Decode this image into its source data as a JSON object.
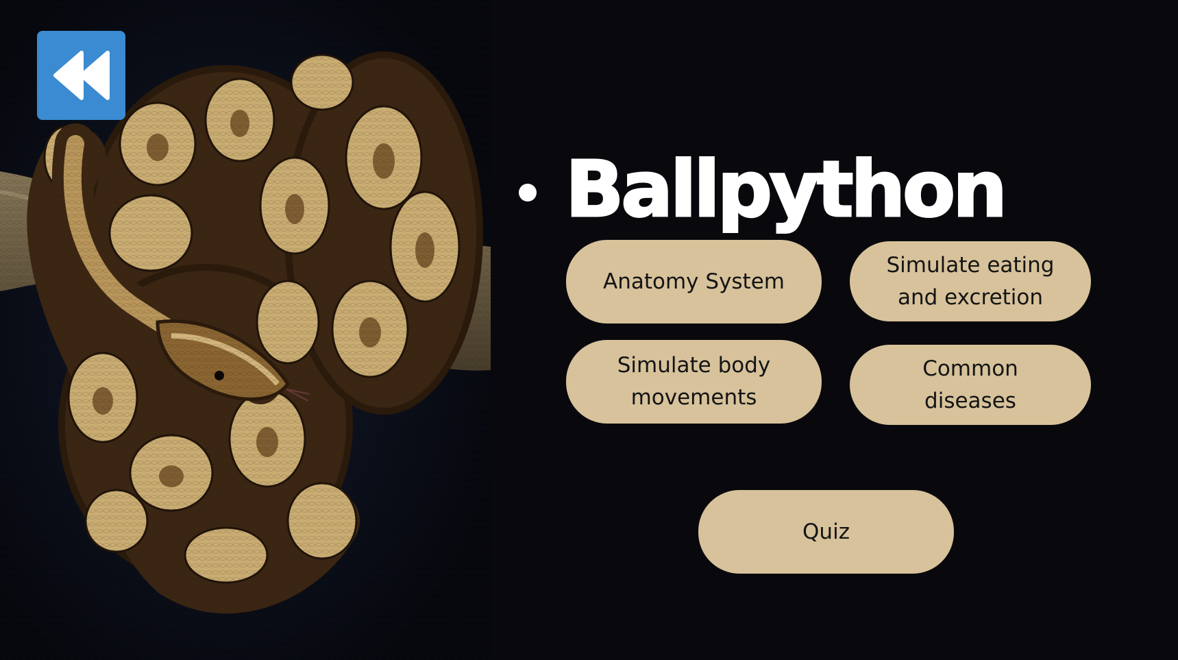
{
  "title": "Ballpython",
  "back_button": {
    "icon": "rewind-icon",
    "color": "#3a8bd1"
  },
  "menu": {
    "anatomy": "Anatomy System",
    "eating": "Simulate eating\nand excretion",
    "movement": "Simulate body\nmovements",
    "diseases": "Common\ndiseases",
    "quiz": "Quiz"
  },
  "colors": {
    "background": "#09090d",
    "pill": "#d7c29b",
    "pill_text": "#141414",
    "title": "#ffffff"
  }
}
